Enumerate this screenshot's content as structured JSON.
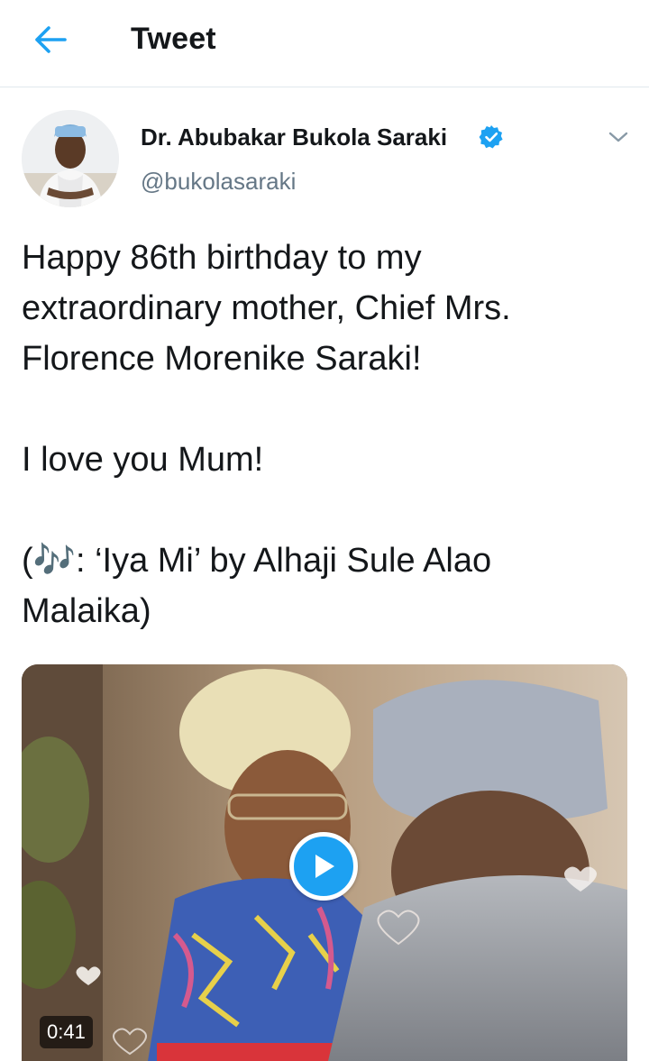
{
  "header": {
    "title": "Tweet",
    "back_icon": "arrow-left-icon",
    "accent_color": "#1da1f2"
  },
  "tweet": {
    "author": {
      "display_name": "Dr. Abubakar Bukola Saraki",
      "handle": "@bukolasaraki",
      "verified": true,
      "verified_icon": "verified-badge-icon"
    },
    "menu_icon": "chevron-down-icon",
    "text": {
      "line1": "Happy 86th birthday to my extraordinary mother, Chief Mrs. Florence Morenike Saraki!",
      "line2": "I love you Mum!",
      "line3": "(🎶: ‘Iya Mi’ by Alhaji Sule Alao Malaika)"
    },
    "media": {
      "type": "video",
      "duration": "0:41",
      "play_icon": "play-icon"
    }
  }
}
